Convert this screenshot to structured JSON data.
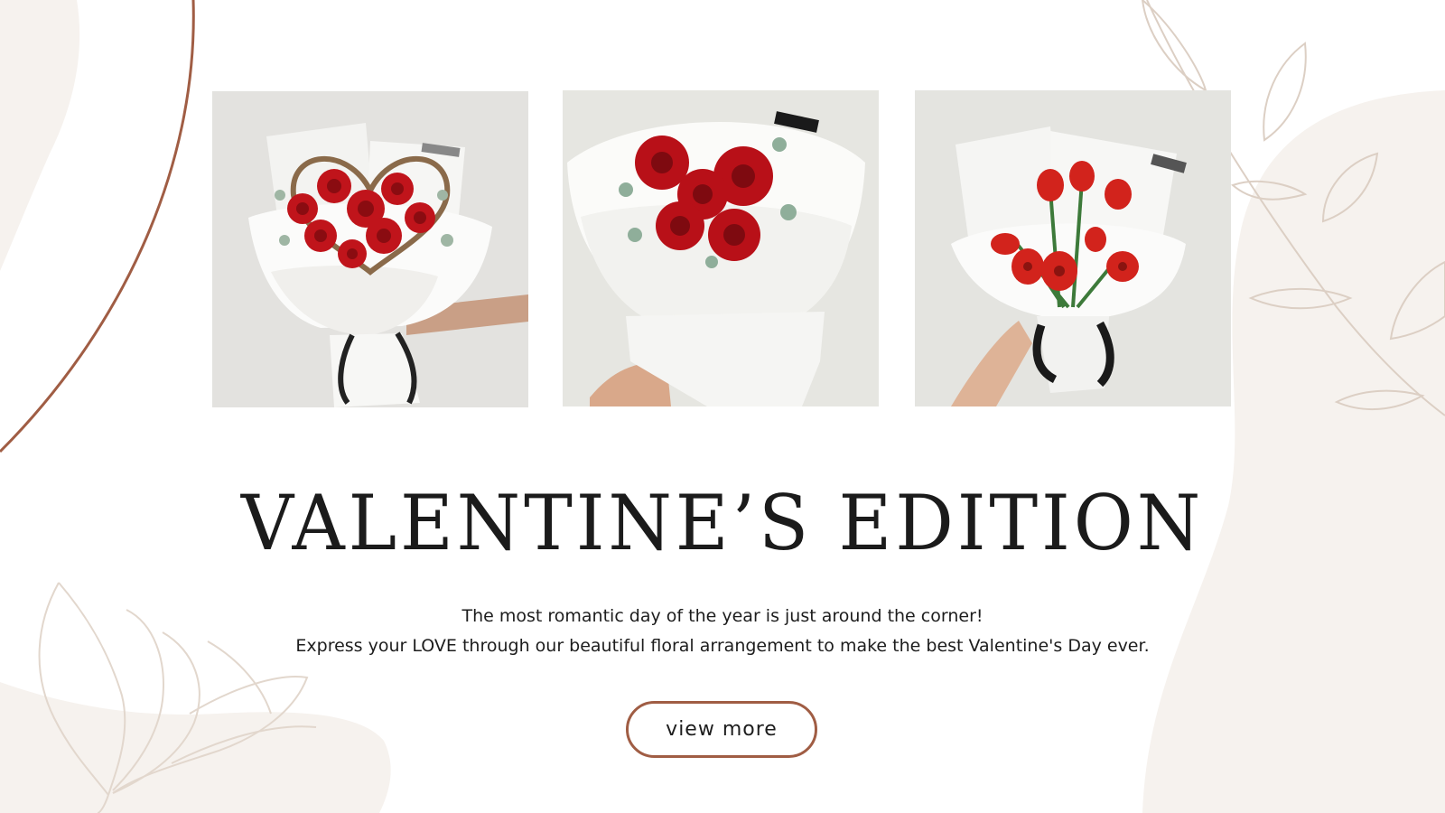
{
  "banner": {
    "title": "VALENTINE’S EDITION",
    "description_line_1": "The most romantic day of the year is just around the corner!",
    "description_line_2": "Express your LOVE through our beautiful floral arrangement to make the best Valentine's Day ever.",
    "cta_label": "view more"
  },
  "products": [
    {
      "name": "heart-wreath-rose-bouquet"
    },
    {
      "name": "red-rose-bouquet"
    },
    {
      "name": "red-tulip-bouquet"
    }
  ],
  "colors": {
    "accent_brown": "#a05d44",
    "beige_blob": "#f6f2ee",
    "leaf_outline": "#e2d7cd",
    "rose_red": "#c0141b",
    "title_text": "#1b1b1b"
  }
}
